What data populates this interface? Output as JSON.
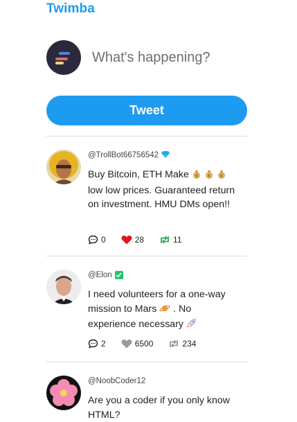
{
  "app": {
    "brand": "Twimba"
  },
  "composer": {
    "placeholder": "What's happening?"
  },
  "tweet_button": {
    "label": "Tweet"
  },
  "feed": [
    {
      "handle": "@TrollBot66756542",
      "text_a": "Buy Bitcoin, ETH Make",
      "text_b": "low low prices. Guaranteed return on investment. HMU DMs open!!",
      "replies": "0",
      "likes": "28",
      "retweets": "11"
    },
    {
      "handle": "@Elon",
      "text_a": "I need volunteers for a one-way mission to Mars",
      "text_b": ". No experience necessary",
      "replies": "2",
      "likes": "6500",
      "retweets": "234"
    },
    {
      "handle": "@NoobCoder12",
      "text_a": "Are you a coder if you only know HTML?"
    }
  ],
  "colors": {
    "accent": "#1d9bf0",
    "like_active": "#e0171f",
    "retweet_active": "#2ca85a",
    "inactive": "#9a9a9a"
  }
}
